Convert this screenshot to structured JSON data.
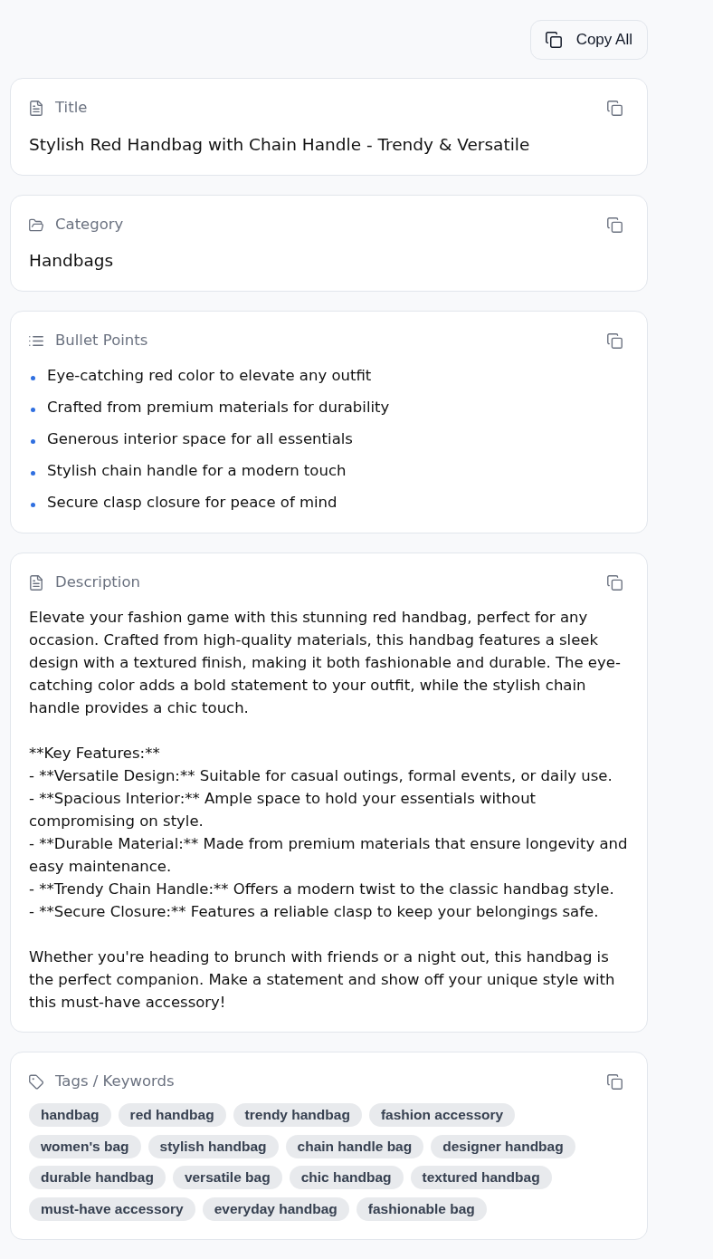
{
  "copy_all_button": {
    "label": "Copy All"
  },
  "title": {
    "label": "Title",
    "value": "Stylish Red Handbag with Chain Handle - Trendy & Versatile"
  },
  "category": {
    "label": "Category",
    "value": "Handbags"
  },
  "bullet_points": {
    "label": "Bullet Points",
    "items": [
      "Eye-catching red color to elevate any outfit",
      "Crafted from premium materials for durability",
      "Generous interior space for all essentials",
      "Stylish chain handle for a modern touch",
      "Secure clasp closure for peace of mind"
    ]
  },
  "description": {
    "label": "Description",
    "paragraphs": [
      [
        "Elevate your fashion game with this stunning red handbag, perfect for any occasion. Crafted from high-quality materials, this handbag features a sleek design with a textured finish, making it both fashionable and durable. The eye-catching color adds a bold statement to your outfit, while the stylish chain handle provides a chic touch."
      ],
      [
        "**Key Features:**",
        "- **Versatile Design:** Suitable for casual outings, formal events, or daily use.",
        "- **Spacious Interior:** Ample space to hold your essentials without compromising on style.",
        "- **Durable Material:** Made from premium materials that ensure longevity and easy maintenance.",
        "- **Trendy Chain Handle:** Offers a modern twist to the classic handbag style.",
        "- **Secure Closure:** Features a reliable clasp to keep your belongings safe."
      ],
      [
        "Whether you're heading to brunch with friends or a night out, this handbag is the perfect companion. Make a statement and show off your unique style with this must-have accessory!"
      ]
    ]
  },
  "tags": {
    "label": "Tags / Keywords",
    "items": [
      "handbag",
      "red handbag",
      "trendy handbag",
      "fashion accessory",
      "women's bag",
      "stylish handbag",
      "chain handle bag",
      "designer handbag",
      "durable handbag",
      "versatile bag",
      "chic handbag",
      "textured handbag",
      "must-have accessory",
      "everyday handbag",
      "fashionable bag"
    ]
  }
}
